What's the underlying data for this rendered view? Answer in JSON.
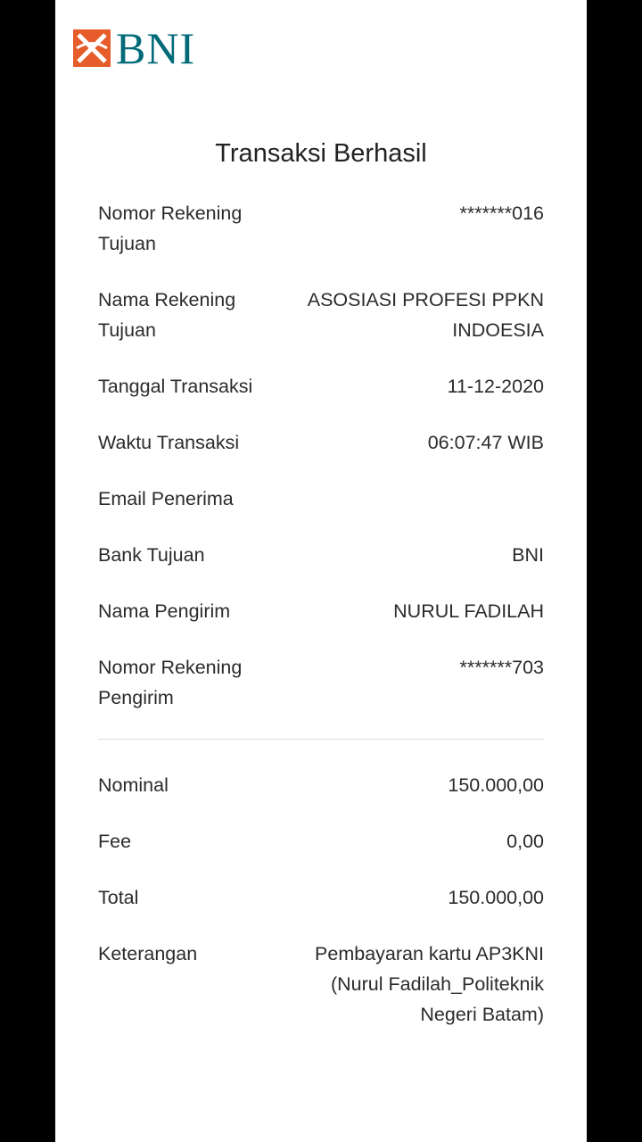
{
  "brand": {
    "logo_text": "BNI",
    "logo_color": "#006a78",
    "accent_color": "#e65c2b"
  },
  "receipt": {
    "title": "Transaksi Berhasil",
    "details": [
      {
        "label": "Nomor Rekening Tujuan",
        "value": "*******016"
      },
      {
        "label": "Nama Rekening Tujuan",
        "value": "ASOSIASI PROFESI PPKN INDOESIA"
      },
      {
        "label": "Tanggal Transaksi",
        "value": "11-12-2020"
      },
      {
        "label": "Waktu Transaksi",
        "value": "06:07:47 WIB"
      },
      {
        "label": "Email Penerima",
        "value": ""
      },
      {
        "label": "Bank Tujuan",
        "value": "BNI"
      },
      {
        "label": "Nama Pengirim",
        "value": "NURUL FADILAH"
      },
      {
        "label": "Nomor Rekening Pengirim",
        "value": "*******703"
      }
    ],
    "amounts": [
      {
        "label": "Nominal",
        "value": "150.000,00"
      },
      {
        "label": "Fee",
        "value": "0,00"
      },
      {
        "label": "Total",
        "value": "150.000,00"
      },
      {
        "label": "Keterangan",
        "value": "Pembayaran kartu AP3KNI (Nurul Fadilah_Politeknik Negeri Batam)"
      }
    ]
  }
}
